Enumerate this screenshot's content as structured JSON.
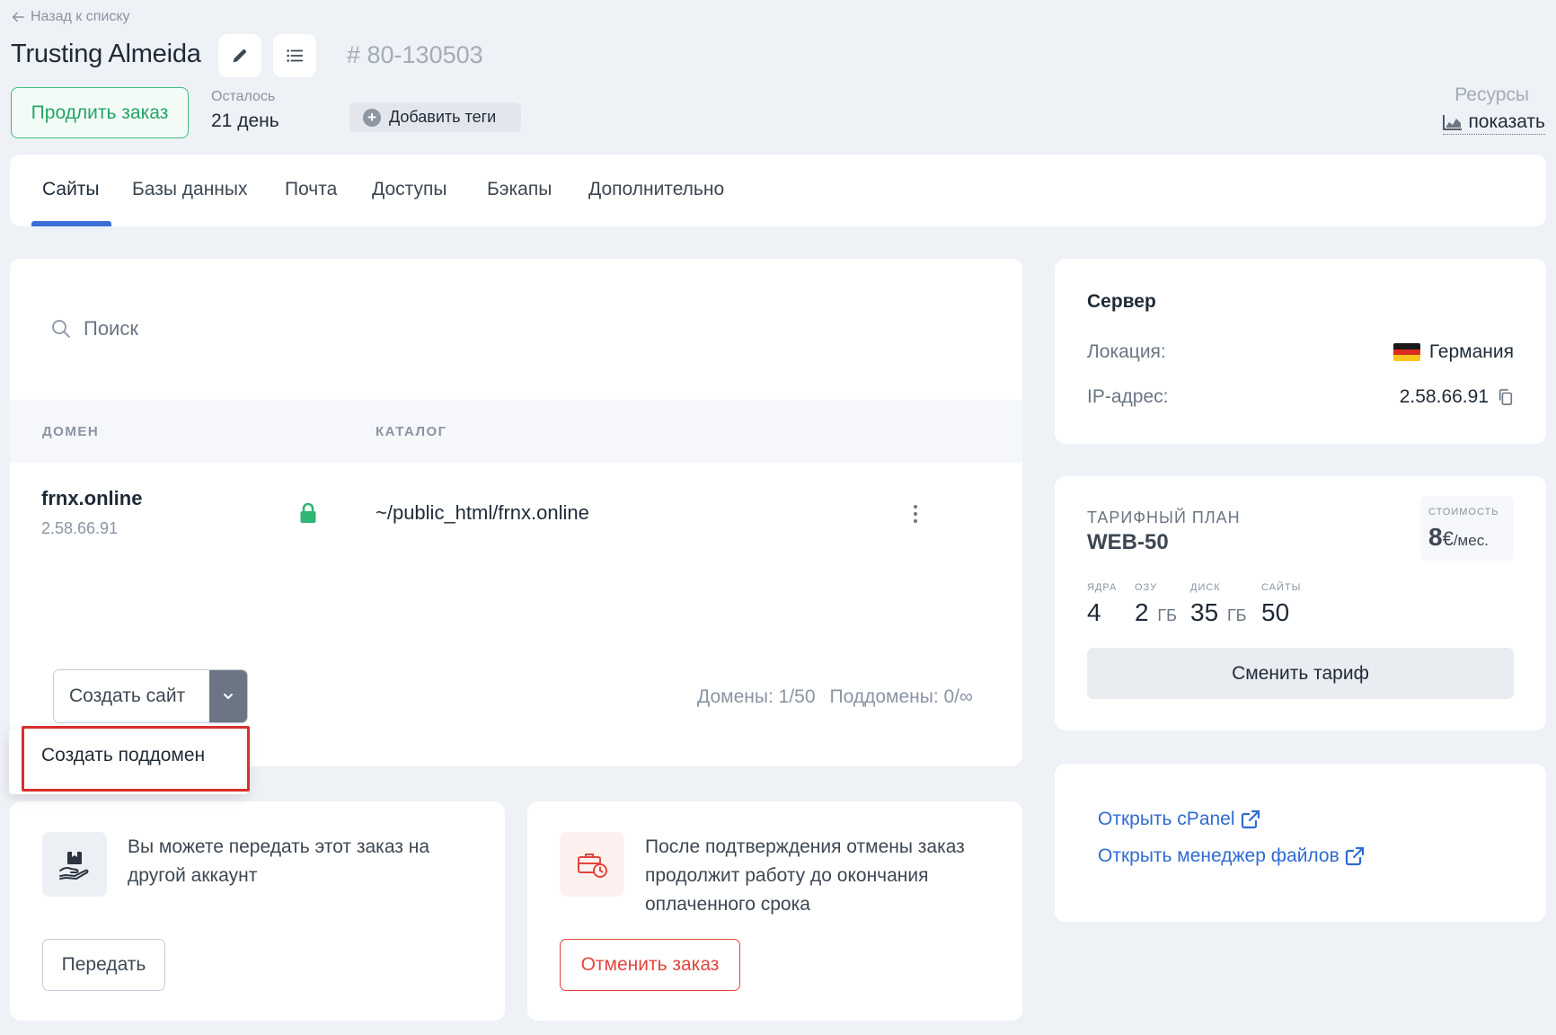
{
  "header": {
    "back_label": "Назад к списку",
    "title": "Trusting Almeida",
    "order_number": "# 80-130503",
    "renew_label": "Продлить заказ",
    "remaining_label": "Осталось",
    "remaining_value": "21 день",
    "add_tags_label": "Добавить теги",
    "resources_label": "Ресурсы",
    "resources_show": "показать"
  },
  "tabs": [
    {
      "label": "Сайты",
      "active": true
    },
    {
      "label": "Базы данных"
    },
    {
      "label": "Почта"
    },
    {
      "label": "Доступы"
    },
    {
      "label": "Бэкапы"
    },
    {
      "label": "Дополнительно"
    }
  ],
  "sites": {
    "search_placeholder": "Поиск",
    "columns": [
      "ДОМЕН",
      "КАТАЛОГ"
    ],
    "rows": [
      {
        "domain": "frnx.online",
        "ip": "2.58.66.91",
        "catalog": "~/public_html/frnx.online",
        "ssl": true
      }
    ],
    "create_label": "Создать сайт",
    "dropdown_item": "Создать поддомен",
    "domains_count": "Домены: 1/50",
    "subdomains_count": "Поддомены: 0/∞"
  },
  "transfer": {
    "text": "Вы можете передать этот заказ на другой аккаунт",
    "button": "Передать"
  },
  "cancel": {
    "text": "После подтверждения отмены заказ продолжит работу до окончания оплаченного срока",
    "button": "Отменить заказ"
  },
  "server": {
    "title": "Сервер",
    "location_label": "Локация:",
    "location_value": "Германия",
    "ip_label": "IP-адрес:",
    "ip_value": "2.58.66.91"
  },
  "plan": {
    "label": "ТАРИФНЫЙ ПЛАН",
    "name": "WEB-50",
    "price_label": "СТОИМОСТЬ",
    "price_amount": "8",
    "price_currency": "€",
    "price_period": "/мес.",
    "specs": [
      {
        "label": "ЯДРА",
        "value": "4",
        "unit": ""
      },
      {
        "label": "ОЗУ",
        "value": "2",
        "unit": "ГБ"
      },
      {
        "label": "ДИСК",
        "value": "35",
        "unit": "ГБ"
      },
      {
        "label": "САЙТЫ",
        "value": "50",
        "unit": ""
      }
    ],
    "change_label": "Сменить тариф"
  },
  "links": {
    "cpanel": "Открыть cPanel",
    "file_manager": "Открыть менеджер файлов"
  },
  "colors": {
    "accent": "#3b6fd8",
    "success": "#22a565",
    "danger": "#e2443b",
    "link": "#2f6bd1"
  }
}
